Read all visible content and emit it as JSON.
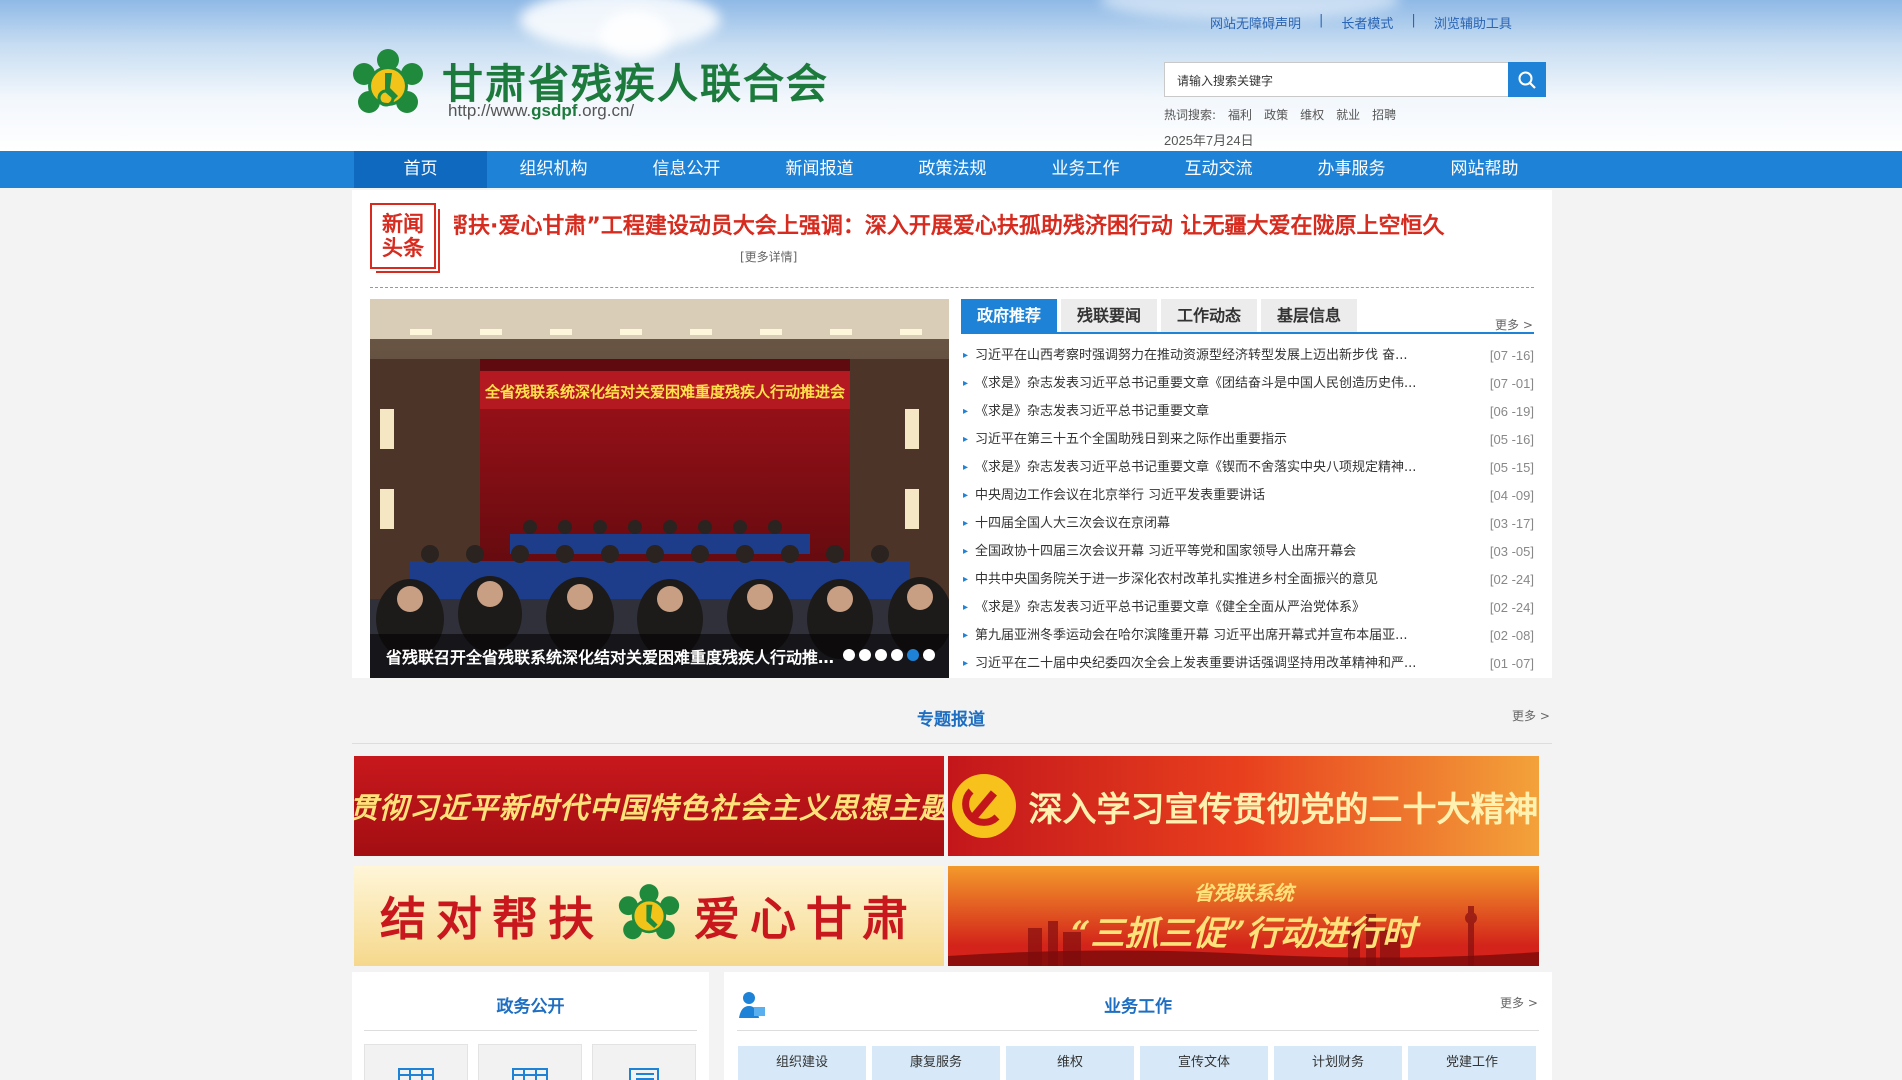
{
  "header": {
    "site_title": "甘肃省残疾人联合会",
    "site_url_prefix": "http://www.",
    "site_url_domain": "gsdpf",
    "site_url_suffix": ".org.cn/",
    "top_links": [
      "网站无障碍声明",
      "长者模式",
      "浏览辅助工具"
    ],
    "search_placeholder": "请输入搜索关键字",
    "hot_label": "热词搜索:",
    "hot_words": [
      "福利",
      "政策",
      "维权",
      "就业",
      "招聘"
    ],
    "date": "2025年7月24日"
  },
  "nav": {
    "items": [
      "首页",
      "组织机构",
      "信息公开",
      "新闻报道",
      "政策法规",
      "业务工作",
      "互动交流",
      "办事服务",
      "网站帮助"
    ]
  },
  "headline": {
    "badge_line1": "新闻",
    "badge_line2": "头条",
    "text": "帮扶·爱心甘肃”工程建设动员大会上强调：深入开展爱心扶孤助残济困行动 让无疆大爱在陇原上空恒久",
    "more": "[更多详情]"
  },
  "slider": {
    "banner_text": "全省残联系统深化结对关爱困难重度残疾人行动推进会",
    "caption": "省残联召开全省残联系统深化结对关爱困难重度残疾人行动推进会",
    "dots": 6,
    "active_dot": 5
  },
  "news": {
    "tabs": [
      "政府推荐",
      "残联要闻",
      "工作动态",
      "基层信息"
    ],
    "more": "更多 >",
    "items": [
      {
        "title": "习近平在山西考察时强调努力在推动资源型经济转型发展上迈出新步伐 奋...",
        "date": "[07 -16]"
      },
      {
        "title": "《求是》杂志发表习近平总书记重要文章《团结奋斗是中国人民创造历史伟...",
        "date": "[07 -01]"
      },
      {
        "title": "《求是》杂志发表习近平总书记重要文章",
        "date": "[06 -19]"
      },
      {
        "title": "习近平在第三十五个全国助残日到来之际作出重要指示",
        "date": "[05 -16]"
      },
      {
        "title": "《求是》杂志发表习近平总书记重要文章《锲而不舍落实中央八项规定精神...",
        "date": "[05 -15]"
      },
      {
        "title": "中央周边工作会议在北京举行 习近平发表重要讲话",
        "date": "[04 -09]"
      },
      {
        "title": "十四届全国人大三次会议在京闭幕",
        "date": "[03 -17]"
      },
      {
        "title": "全国政协十四届三次会议开幕 习近平等党和国家领导人出席开幕会",
        "date": "[03 -05]"
      },
      {
        "title": "中共中央国务院关于进一步深化农村改革扎实推进乡村全面振兴的意见",
        "date": "[02 -24]"
      },
      {
        "title": "《求是》杂志发表习近平总书记重要文章《健全全面从严治党体系》",
        "date": "[02 -24]"
      },
      {
        "title": "第九届亚洲冬季运动会在哈尔滨隆重开幕 习近平出席开幕式并宣布本届亚...",
        "date": "[02 -08]"
      },
      {
        "title": "习近平在二十届中央纪委四次全会上发表重要讲话强调坚持用改革精神和严...",
        "date": "[01 -07]"
      }
    ]
  },
  "special": {
    "title": "专题报道",
    "more": "更多 >",
    "banners": [
      "学习贯彻习近平新时代中国特色社会主义思想主题教育",
      "深入学习宣传贯彻党的二十大精神",
      "结对帮扶",
      "爱心甘肃",
      "省残联系统",
      "“三抓三促”行动进行时"
    ]
  },
  "gov": {
    "title": "政务公开"
  },
  "biz": {
    "title": "业务工作",
    "more": "更多 >",
    "tabs": [
      "组织建设",
      "康复服务",
      "维权",
      "宣传文体",
      "计划财务",
      "党建工作"
    ]
  },
  "colors": {
    "nav_blue": "#1e83d6",
    "title_green": "#1d7a3d",
    "headline_red": "#d62b1e"
  }
}
